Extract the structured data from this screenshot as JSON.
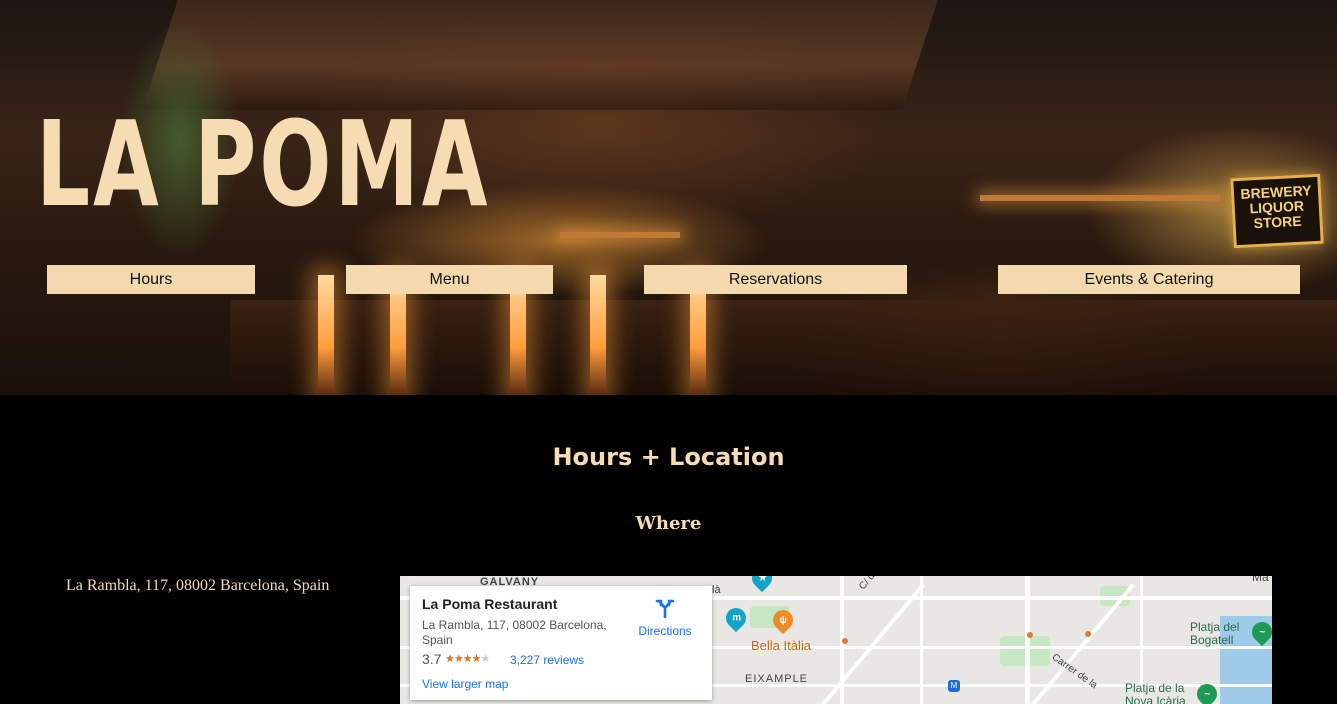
{
  "brand": {
    "logo": "LA POMA",
    "sign": "BREWERY LIQUOR STORE"
  },
  "nav": [
    {
      "label": "Hours"
    },
    {
      "label": "Menu"
    },
    {
      "label": "Reservations"
    },
    {
      "label": "Events & Catering"
    }
  ],
  "section": {
    "title": "Hours + Location",
    "subtitle": "Where",
    "address": "La Rambla, 117, 08002 Barcelona, Spain"
  },
  "map": {
    "card": {
      "name": "La Poma Restaurant",
      "address": "La Rambla, 117, 08002 Barcelona, Spain",
      "rating": "3.7",
      "stars_filled": 3.5,
      "reviews": "3,227 reviews",
      "directions": "Directions",
      "larger_map": "View larger map"
    },
    "labels": {
      "galvany": "GALVANY",
      "bella": "Bella Itàlia",
      "eixample": "EIXAMPLE",
      "la_frag": "là",
      "bogatell": "Platja del Bogatell",
      "nova_icaria": "Platja de la Nova Icària",
      "carrer": "Carrer de la",
      "cd": "C/ d",
      "ma": "Ma"
    },
    "colors": {
      "accent": "#f5d9ae",
      "link": "#1a73e8",
      "star": "#e7711b"
    }
  }
}
